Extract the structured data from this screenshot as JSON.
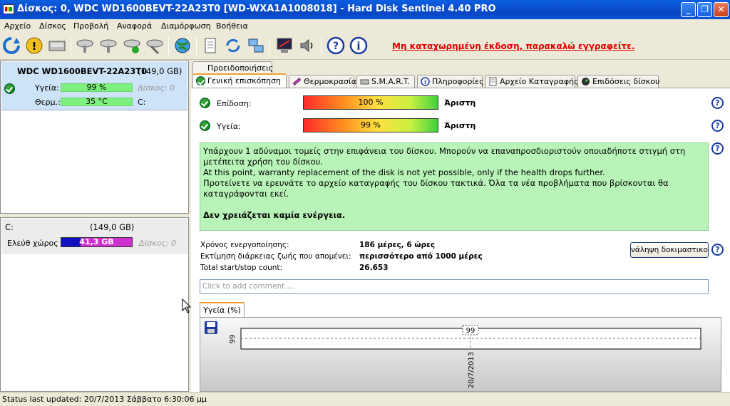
{
  "window": {
    "title": "Δίσκος: 0, WDC WD1600BEVT-22A23T0 [WD-WXA1A1008018]  -  Hard Disk Sentinel 4.40 PRO"
  },
  "menu": [
    "Αρχείο",
    "Δίσκος",
    "Προβολή",
    "Αναφορά",
    "Διαμόρφωση",
    "Βοήθεια"
  ],
  "toolbar": {
    "registration_notice": "Μη καταχωρημένη έκδοση, παρακαλώ εγγραφείτε."
  },
  "disk_card": {
    "name": "WDC WD1600BEVT-22A23T0",
    "size": "(149,0 GB)",
    "health_label": "Υγεία:",
    "health_value": "99 %",
    "health_disk": "Δίσκος: 0",
    "temp_label": "Θερμ.:",
    "temp_value": "35 °C",
    "temp_drive": "C:"
  },
  "volume_card": {
    "name": "C:",
    "size": "(149,0 GB)",
    "free_label": "Ελεύθ χώρος",
    "free_value": "41,3 GB",
    "free_fraction": 0.277,
    "disk": "Δίσκος: 0"
  },
  "tabs": {
    "notifications": "Προειδοποιήσεις",
    "overview": "Γενική επισκόπηση",
    "temperature": "Θερμοκρασία",
    "smart": "S.M.A.R.T.",
    "info": "Πληροφορίες",
    "log": "Αρχείο Καταγραφής",
    "performance": "Επιδόσεις δίσκου"
  },
  "overview": {
    "performance_label": "Επίδοση:",
    "performance_value": "100 %",
    "performance_status": "Άριστη",
    "health_label": "Υγεία:",
    "health_value": "99 %",
    "health_status": "Άριστη",
    "message": [
      "Υπάρχουν 1 αδύναμοι τομείς στην επιφάνεια του δίσκου. Μπορούν να επαναπροσδιοριστούν οποιαδήποτε στιγμή στη μετέπειτα χρήση του δίσκου.",
      "At this point, warranty replacement of the disk is not yet possible, only if the health drops further.",
      "Προτείνετε να ερευνάτε το αρχείο καταγραφής του δίσκου τακτικά. Όλα τα νέα προβλήματα που βρίσκονται θα καταγράφονται εκεί."
    ],
    "action": "Δεν χρειάζεται καμία ενέργεια.",
    "power_on_label": "Χρόνος ενεργοποίησης:",
    "power_on_value": "186 μέρες, 6 ώρες",
    "lifetime_label": "Εκτίμηση διάρκειας ζωής που απομένει:",
    "lifetime_value": "περισσότερο από 1000 μέρες",
    "startstop_label": "Total start/stop count:",
    "startstop_value": "26.653",
    "test_button": "νάληψη δοκιμαστικού",
    "comment_placeholder": "Click to add comment ..."
  },
  "chart_data": {
    "type": "line",
    "tab_label": "Υγεία (%)",
    "x": [
      "20/7/2013"
    ],
    "values": [
      99
    ],
    "ytick": "99",
    "data_label": "99"
  },
  "status": {
    "text": "Status last updated: 20/7/2013 Σάββατο 6:30:06 μμ"
  }
}
